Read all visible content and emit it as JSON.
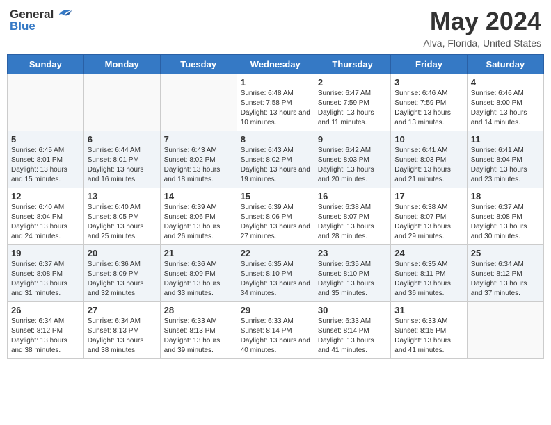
{
  "header": {
    "logo_general": "General",
    "logo_blue": "Blue",
    "month_title": "May 2024",
    "location": "Alva, Florida, United States"
  },
  "days_of_week": [
    "Sunday",
    "Monday",
    "Tuesday",
    "Wednesday",
    "Thursday",
    "Friday",
    "Saturday"
  ],
  "weeks": [
    [
      {
        "num": "",
        "info": ""
      },
      {
        "num": "",
        "info": ""
      },
      {
        "num": "",
        "info": ""
      },
      {
        "num": "1",
        "info": "Sunrise: 6:48 AM\nSunset: 7:58 PM\nDaylight: 13 hours and 10 minutes."
      },
      {
        "num": "2",
        "info": "Sunrise: 6:47 AM\nSunset: 7:59 PM\nDaylight: 13 hours and 11 minutes."
      },
      {
        "num": "3",
        "info": "Sunrise: 6:46 AM\nSunset: 7:59 PM\nDaylight: 13 hours and 13 minutes."
      },
      {
        "num": "4",
        "info": "Sunrise: 6:46 AM\nSunset: 8:00 PM\nDaylight: 13 hours and 14 minutes."
      }
    ],
    [
      {
        "num": "5",
        "info": "Sunrise: 6:45 AM\nSunset: 8:01 PM\nDaylight: 13 hours and 15 minutes."
      },
      {
        "num": "6",
        "info": "Sunrise: 6:44 AM\nSunset: 8:01 PM\nDaylight: 13 hours and 16 minutes."
      },
      {
        "num": "7",
        "info": "Sunrise: 6:43 AM\nSunset: 8:02 PM\nDaylight: 13 hours and 18 minutes."
      },
      {
        "num": "8",
        "info": "Sunrise: 6:43 AM\nSunset: 8:02 PM\nDaylight: 13 hours and 19 minutes."
      },
      {
        "num": "9",
        "info": "Sunrise: 6:42 AM\nSunset: 8:03 PM\nDaylight: 13 hours and 20 minutes."
      },
      {
        "num": "10",
        "info": "Sunrise: 6:41 AM\nSunset: 8:03 PM\nDaylight: 13 hours and 21 minutes."
      },
      {
        "num": "11",
        "info": "Sunrise: 6:41 AM\nSunset: 8:04 PM\nDaylight: 13 hours and 23 minutes."
      }
    ],
    [
      {
        "num": "12",
        "info": "Sunrise: 6:40 AM\nSunset: 8:04 PM\nDaylight: 13 hours and 24 minutes."
      },
      {
        "num": "13",
        "info": "Sunrise: 6:40 AM\nSunset: 8:05 PM\nDaylight: 13 hours and 25 minutes."
      },
      {
        "num": "14",
        "info": "Sunrise: 6:39 AM\nSunset: 8:06 PM\nDaylight: 13 hours and 26 minutes."
      },
      {
        "num": "15",
        "info": "Sunrise: 6:39 AM\nSunset: 8:06 PM\nDaylight: 13 hours and 27 minutes."
      },
      {
        "num": "16",
        "info": "Sunrise: 6:38 AM\nSunset: 8:07 PM\nDaylight: 13 hours and 28 minutes."
      },
      {
        "num": "17",
        "info": "Sunrise: 6:38 AM\nSunset: 8:07 PM\nDaylight: 13 hours and 29 minutes."
      },
      {
        "num": "18",
        "info": "Sunrise: 6:37 AM\nSunset: 8:08 PM\nDaylight: 13 hours and 30 minutes."
      }
    ],
    [
      {
        "num": "19",
        "info": "Sunrise: 6:37 AM\nSunset: 8:08 PM\nDaylight: 13 hours and 31 minutes."
      },
      {
        "num": "20",
        "info": "Sunrise: 6:36 AM\nSunset: 8:09 PM\nDaylight: 13 hours and 32 minutes."
      },
      {
        "num": "21",
        "info": "Sunrise: 6:36 AM\nSunset: 8:09 PM\nDaylight: 13 hours and 33 minutes."
      },
      {
        "num": "22",
        "info": "Sunrise: 6:35 AM\nSunset: 8:10 PM\nDaylight: 13 hours and 34 minutes."
      },
      {
        "num": "23",
        "info": "Sunrise: 6:35 AM\nSunset: 8:10 PM\nDaylight: 13 hours and 35 minutes."
      },
      {
        "num": "24",
        "info": "Sunrise: 6:35 AM\nSunset: 8:11 PM\nDaylight: 13 hours and 36 minutes."
      },
      {
        "num": "25",
        "info": "Sunrise: 6:34 AM\nSunset: 8:12 PM\nDaylight: 13 hours and 37 minutes."
      }
    ],
    [
      {
        "num": "26",
        "info": "Sunrise: 6:34 AM\nSunset: 8:12 PM\nDaylight: 13 hours and 38 minutes."
      },
      {
        "num": "27",
        "info": "Sunrise: 6:34 AM\nSunset: 8:13 PM\nDaylight: 13 hours and 38 minutes."
      },
      {
        "num": "28",
        "info": "Sunrise: 6:33 AM\nSunset: 8:13 PM\nDaylight: 13 hours and 39 minutes."
      },
      {
        "num": "29",
        "info": "Sunrise: 6:33 AM\nSunset: 8:14 PM\nDaylight: 13 hours and 40 minutes."
      },
      {
        "num": "30",
        "info": "Sunrise: 6:33 AM\nSunset: 8:14 PM\nDaylight: 13 hours and 41 minutes."
      },
      {
        "num": "31",
        "info": "Sunrise: 6:33 AM\nSunset: 8:15 PM\nDaylight: 13 hours and 41 minutes."
      },
      {
        "num": "",
        "info": ""
      }
    ]
  ]
}
